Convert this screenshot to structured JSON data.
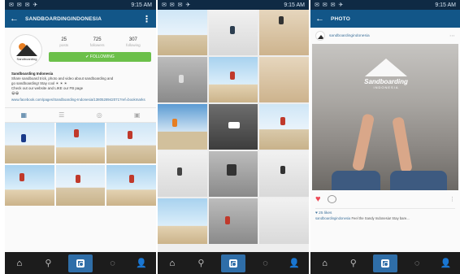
{
  "status_bar": {
    "left_icons": "✉ ✉ ✉ ✈",
    "time": "9:15 AM"
  },
  "panel1": {
    "title": "SANDBOARDINGINDONESIA",
    "avatar_text": "Sandboarding",
    "stats": [
      {
        "num": "25",
        "key": "posts"
      },
      {
        "num": "725",
        "key": "followers"
      },
      {
        "num": "307",
        "key": "following"
      }
    ],
    "follow_label": "✔ FOLLOWING",
    "bio_name": "Sandboarding Indonesia",
    "bio_lines": [
      "Share sandboard trick, photo and video about sandboarding and",
      "go sandboarding! Stay cool ☀ ☀ ☀",
      "Check out our website and LIKE our FB page",
      "😀😀"
    ],
    "bio_link": "www.facebook.com/pages/Sandboarding-Indonesia/1380528942071?ref=bookmarks"
  },
  "panel3": {
    "title": "PHOTO",
    "username": "sandboardingindonesia",
    "logo_word": "Sandboarding",
    "logo_sub": "INDONESIA",
    "likes": "♥ 25 likes",
    "caption_user": "sandboardingindonesia",
    "caption_text": "Feel the Sandy Indonesia! Stay bare..."
  },
  "icons": {
    "back": "arrow-left-icon",
    "overflow": "more-vert-icon",
    "home": "home-icon",
    "search": "search-icon",
    "camera": "camera-icon",
    "activity": "comment-bubble-icon",
    "profile": "person-icon"
  },
  "colors": {
    "app_bar": "#125688",
    "status_bar": "#0f2a44",
    "follow_green": "#6cc04a",
    "camera_blue": "#2f6ea8",
    "heart_red": "#ed4956"
  }
}
